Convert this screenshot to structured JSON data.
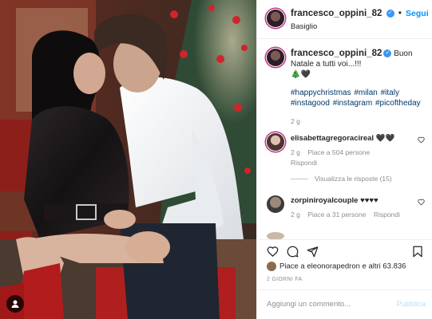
{
  "post_header": {
    "username": "francesco_oppini_82",
    "follow_label": "Segui",
    "location": "Basiglio"
  },
  "caption": {
    "username": "francesco_oppini_82",
    "text": "Buon Natale a tutti voi...!!!",
    "emoji_line": "🎄🖤",
    "hashtags": "#happychristmas #milan #italy #instagood #instagram #picoftheday",
    "age": "2 g"
  },
  "comments": [
    {
      "username": "elisabettagregoraciReal",
      "display_username": "elisabettagregoracireal",
      "text": "🖤🖤",
      "age": "2 g",
      "likes": "Piace a 504 persone",
      "reply_label": "Rispondi"
    },
    {
      "username": "zorpiniroyalcouple",
      "text": "♥♥♥♥",
      "age": "2 g",
      "likes": "Piace a 31 persone",
      "reply_label": "Rispondi"
    }
  ],
  "view_replies_label": "Visualizza le risposte (15)",
  "likes_summary": "Piace a eleonorapedron e altri 63.836",
  "post_age": "2 GIORNI FA",
  "add_comment": {
    "placeholder": "Aggiungi un commento...",
    "publish_label": "Pubblica"
  },
  "icons": {
    "like": "heart-icon",
    "comment": "comment-icon",
    "share": "send-icon",
    "save": "bookmark-icon",
    "tag": "user-tag-icon"
  },
  "colors": {
    "accent": "#0095f6",
    "verified": "#3897f0",
    "hashtag": "#00376b",
    "muted": "#8e8e8e"
  }
}
